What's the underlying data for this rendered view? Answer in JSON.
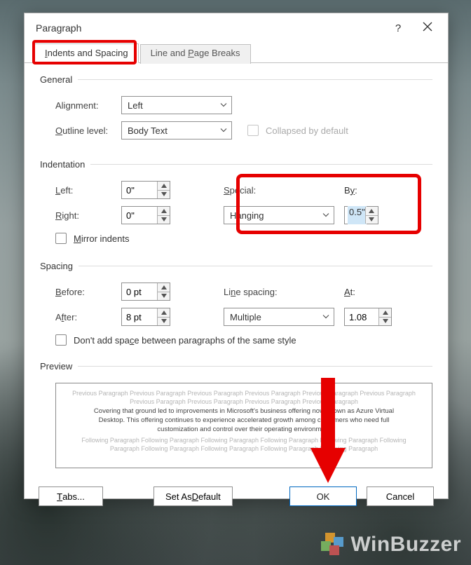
{
  "window": {
    "title": "Paragraph",
    "help_char": "?",
    "close_label": "Close"
  },
  "tabs": {
    "active": "Indents and Spacing",
    "inactive": "Line and Page Breaks"
  },
  "general": {
    "heading": "General",
    "alignment_label": "Alignment:",
    "alignment_value": "Left",
    "outline_label": "Outline level:",
    "outline_value": "Body Text",
    "collapsed_label": "Collapsed by default"
  },
  "indentation": {
    "heading": "Indentation",
    "left_label": "Left:",
    "left_value": "0\"",
    "right_label": "Right:",
    "right_value": "0\"",
    "special_label": "Special:",
    "special_value": "Hanging",
    "by_label": "By:",
    "by_value": "0.5\"",
    "mirror_label": "Mirror indents"
  },
  "spacing": {
    "heading": "Spacing",
    "before_label": "Before:",
    "before_value": "0 pt",
    "after_label": "After:",
    "after_value": "8 pt",
    "linespacing_label": "Line spacing:",
    "linespacing_value": "Multiple",
    "at_label": "At:",
    "at_value": "1.08",
    "no_space_label": "Don't add space between paragraphs of the same style"
  },
  "preview": {
    "heading": "Preview",
    "placeholder_prev": "Previous Paragraph Previous Paragraph Previous Paragraph Previous Paragraph Previous Paragraph Previous Paragraph Previous Paragraph Previous Paragraph Previous Paragraph Previous Paragraph",
    "sample": "Covering that ground led to improvements in Microsoft's business offering now known as Azure Virtual Desktop. This offering continues to experience accelerated growth among customers who need full customization and control over their operating environment",
    "placeholder_next": "Following Paragraph Following Paragraph Following Paragraph Following Paragraph Following Paragraph Following Paragraph Following Paragraph Following Paragraph Following Paragraph Following Paragraph"
  },
  "buttons": {
    "tabs": "Tabs...",
    "set_default": "Set As Default",
    "ok": "OK",
    "cancel": "Cancel"
  },
  "watermark": "WinBuzzer"
}
